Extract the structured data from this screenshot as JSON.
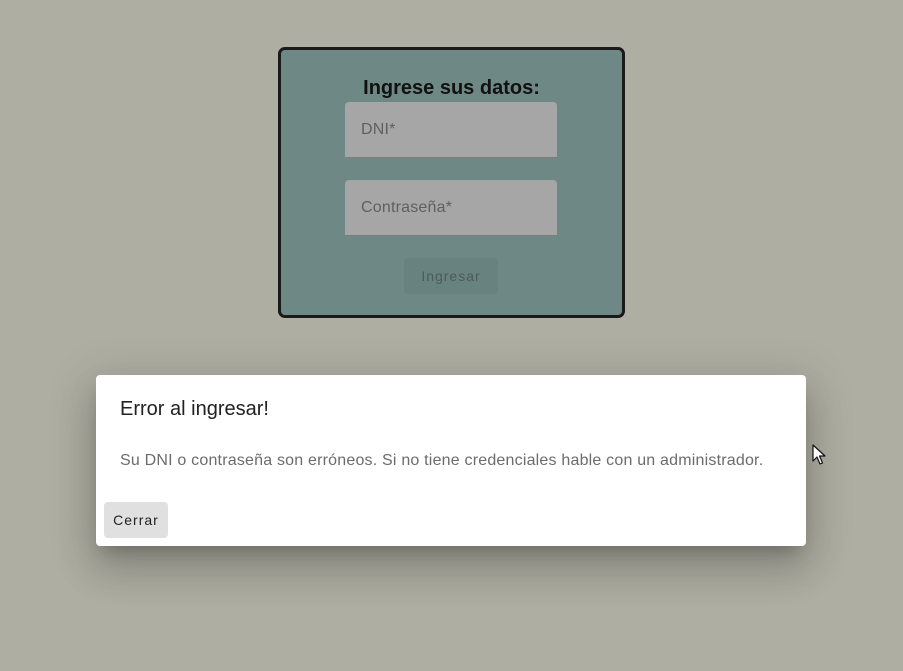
{
  "login": {
    "title": "Ingrese sus datos:",
    "dni_label": "DNI*",
    "password_label": "Contraseña*",
    "submit_label": "Ingresar"
  },
  "dialog": {
    "title": "Error al ingresar!",
    "message": "Su DNI o contraseña son erróneos. Si no tiene credenciales hable con un administrador.",
    "close_label": "Cerrar"
  },
  "colors": {
    "background": "#aeaea2",
    "card": "#6e8886",
    "field": "#a6a6a6",
    "dialog": "#ffffff"
  },
  "icons": {
    "cursor": "mouse-pointer-icon"
  }
}
